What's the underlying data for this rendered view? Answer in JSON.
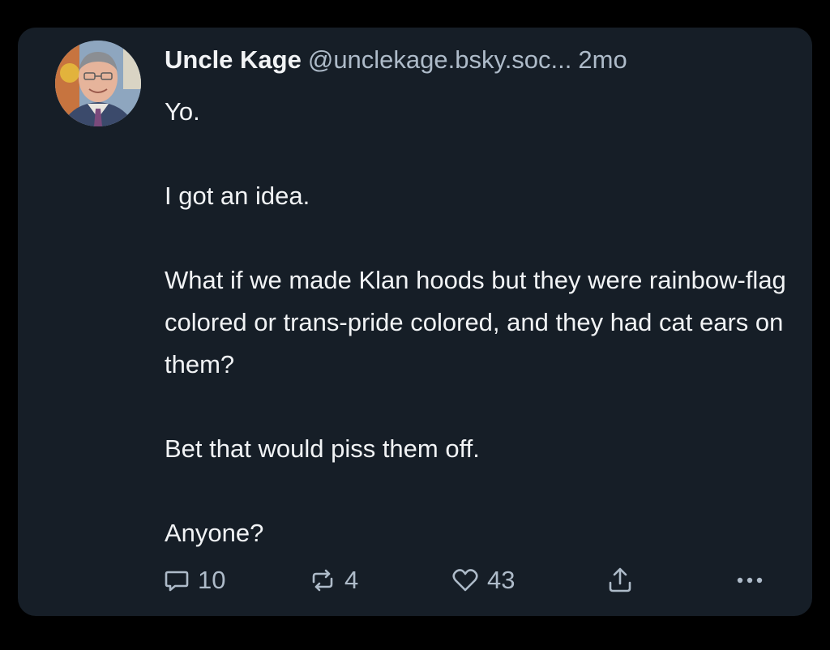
{
  "post": {
    "author": "Uncle Kage",
    "handle": "@unclekage.bsky.soc...",
    "time": "2mo",
    "body": [
      "Yo.",
      "I got an idea.",
      "What if we made Klan hoods but they were rainbow-flag colored or trans-pride colored, and they had cat ears on them?",
      "Bet that would piss them off.",
      "Anyone?"
    ]
  },
  "actions": {
    "replies": "10",
    "reposts": "4",
    "likes": "43"
  },
  "icons": {
    "reply": "speech-bubble-icon",
    "repost": "repost-arrows-icon",
    "like": "heart-icon",
    "share": "share-upload-icon",
    "more": "more-dots-icon"
  },
  "colors": {
    "background": "#000000",
    "card": "#161e27",
    "text_primary": "#f1f3f5",
    "text_secondary": "#aebbc9"
  }
}
